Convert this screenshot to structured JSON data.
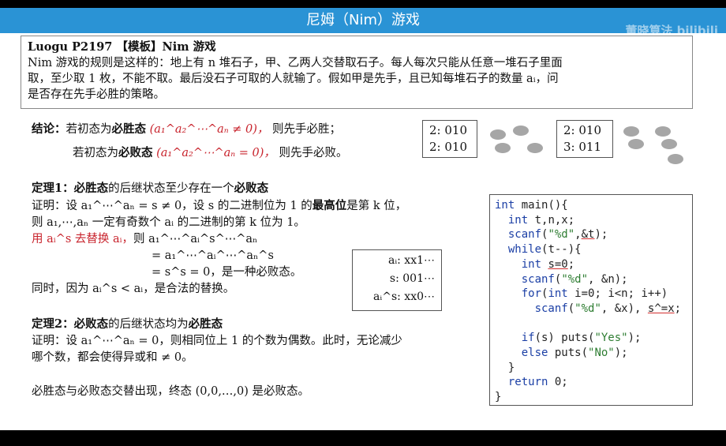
{
  "header": {
    "title": "尼姆（Nim）游戏",
    "watermark": "董晓算法 bilibili"
  },
  "problem": {
    "title": "Luogu P2197 【模板】Nim 游戏",
    "line1": "Nim 游戏的规则是这样的：地上有 n 堆石子，甲、乙两人交替取石子。每人每次只能从任意一堆石子里面",
    "line2": "取，至少取 1 枚，不能不取。最后没石子可取的人就输了。假如甲是先手，且已知每堆石子的数量 aᵢ，问",
    "line3": "是否存在先手必胜的策略。"
  },
  "conclusion": {
    "label": "结论：",
    "line1_pre": "若初态为",
    "line1_bold": "必胜态",
    "line1_math": "(a₁^a₂^⋯^aₙ ≠ 0)，",
    "line1_post": "则先手必胜；",
    "line2_pre": "若初态为",
    "line2_bold": "必败态",
    "line2_math": "(a₁^a₂^⋯^aₙ = 0)，",
    "line2_post": "则先手必败。"
  },
  "binary_examples": {
    "left": [
      "2: 010",
      "2: 010"
    ],
    "right": [
      "2: 010",
      "3: 011"
    ]
  },
  "theorem1": {
    "title_pre": "定理1：",
    "title_b1": "必胜态",
    "title_mid": "的后继状态至少存在一个",
    "title_b2": "必败态",
    "line1_pre": "证明：设 a₁^⋯^aₙ = s ≠ 0，设 s 的二进制位为 1 的",
    "line1_bold": "最高位",
    "line1_post": "是第 k 位，",
    "line2": "则 a₁,⋯,aₙ 一定有奇数个 aᵢ 的二进制的第 k 位为 1。",
    "line3_red": "用 aᵢ^s 去替换 aᵢ，",
    "line3_post": "则 a₁^⋯^aᵢ^s^⋯^aₙ",
    "line4": "= a₁^⋯^aᵢ^⋯^aₙ^s",
    "line5": "= s^s = 0，是一种必败态。",
    "line6": "同时，因为 aᵢ^s < aᵢ，是合法的替换。"
  },
  "xor_box": {
    "rows": [
      "aᵢ: xx1⋯",
      "s: 001⋯",
      "aᵢ^s: xx0⋯"
    ]
  },
  "theorem2": {
    "title_pre": "定理2：",
    "title_b1": "必败态",
    "title_mid": "的后继状态均为",
    "title_b2": "必胜态",
    "line1": "证明：设 a₁^⋯^aₙ = 0，则相同位上 1 的个数为偶数。此时，无论减少",
    "line2": "哪个数，都会使得异或和 ≠ 0。"
  },
  "summary": "必胜态与必败态交替出现，终态 (0,0,…,0) 是必败态。",
  "code": [
    "int main(){",
    "  int t,n,x;",
    "  scanf(\"%d\",&t);",
    "  while(t--){",
    "    int s=0;",
    "    scanf(\"%d\", &n);",
    "    for(int i=0; i<n; i++)",
    "      scanf(\"%d\", &x), s^=x;",
    "",
    "    if(s) puts(\"Yes\");",
    "    else puts(\"No\");",
    "  }",
    "  return 0;",
    "}"
  ],
  "colors": {
    "title_bar": "#2a93d5",
    "emphasis_red": "#c8232c",
    "stone_gray": "#a6a6a6"
  }
}
